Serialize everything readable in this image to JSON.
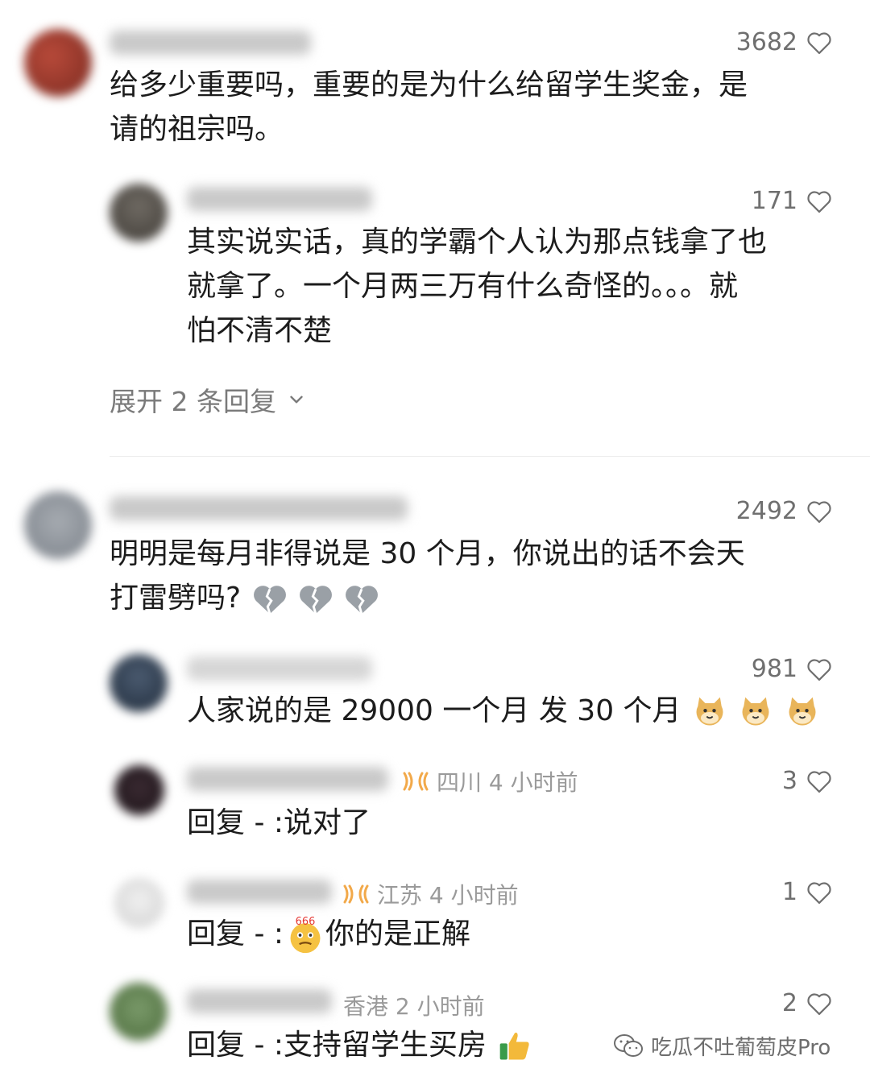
{
  "colors": {
    "text": "#1c1c1c",
    "meta": "#9a9a9a",
    "likes": "#6f6f6f",
    "verified": "#f2a94a"
  },
  "c1": {
    "likes": "3682",
    "line1": "给多少重要吗，重要的是为什么给留学生奖金，是",
    "line2": "请的祖宗吗。"
  },
  "c1r1": {
    "likes": "171",
    "line1": "其实说实话，真的学霸个人认为那点钱拿了也",
    "line2": "就拿了。一个月两三万有什么奇怪的。。。就",
    "line3": "怕不清不楚"
  },
  "expand": {
    "label": "展开 2 条回复"
  },
  "c2": {
    "likes": "2492",
    "line1": "明明是每月非得说是 30 个月，你说出的话不会天",
    "line2": "打雷劈吗?"
  },
  "c2r1": {
    "likes": "981",
    "text": "人家说的是 29000 一个月  发 30 个月"
  },
  "c2r2": {
    "likes": "3",
    "meta": "四川 4 小时前",
    "text": "回复 - :说对了"
  },
  "c2r3": {
    "likes": "1",
    "meta": "江苏 4 小时前",
    "text_pre": "回复 - :",
    "text_post": "你的是正解",
    "emoji_label": "666"
  },
  "c2r4": {
    "likes": "2",
    "meta": "香港 2 小时前",
    "text": "回复 - :支持留学生买房"
  },
  "watermark": "吃瓜不吐葡萄皮Pro",
  "icons": {
    "like": "heart-outline-icon",
    "verified": "verified-badge-icon",
    "expand": "chevron-down-icon",
    "watermark": "wechat-icon"
  }
}
